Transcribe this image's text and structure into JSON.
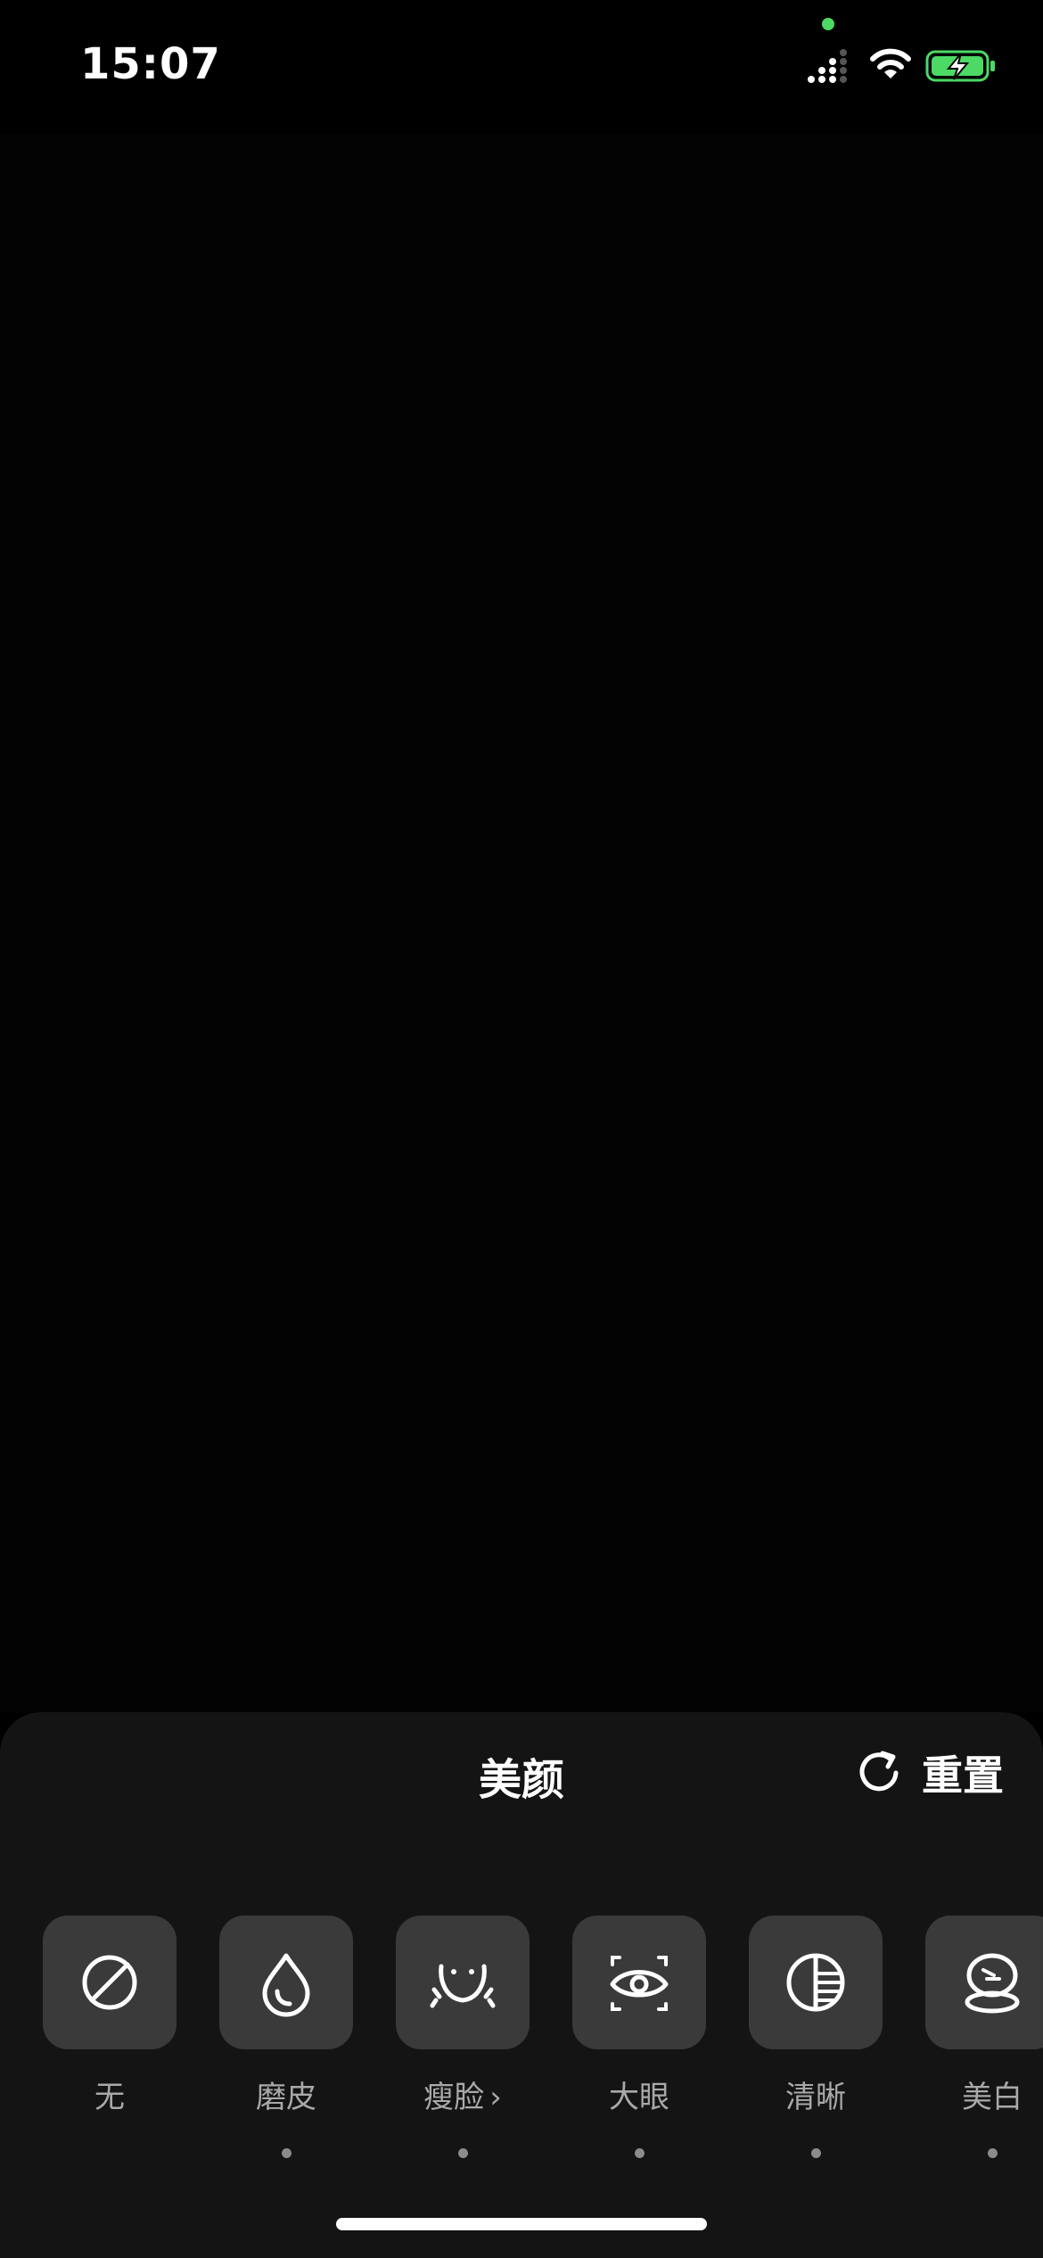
{
  "status_bar": {
    "time": "15:07",
    "icons": [
      "signal-icon",
      "wifi-icon",
      "battery-charging-icon"
    ],
    "colors": {
      "privacy_dot": "#4cd964",
      "battery": "#4cd964"
    }
  },
  "panel": {
    "title": "美颜",
    "reset_label": "重置",
    "reset_icon": "refresh-icon"
  },
  "tools": [
    {
      "label": "无",
      "icon": "none-icon",
      "has_dot": false
    },
    {
      "label": "磨皮",
      "icon": "droplet-icon",
      "has_dot": true
    },
    {
      "label": "瘦脸",
      "icon": "face-slim-icon",
      "has_dot": true,
      "suffix": "›"
    },
    {
      "label": "大眼",
      "icon": "eye-icon",
      "has_dot": true
    },
    {
      "label": "清晰",
      "icon": "clarity-icon",
      "has_dot": true
    },
    {
      "label": "美白",
      "icon": "whiten-icon",
      "has_dot": true
    }
  ],
  "colors": {
    "background": "#000000",
    "panel": "#141414",
    "tool_box": "#3a3a3a",
    "label": "#a9a9a9"
  }
}
